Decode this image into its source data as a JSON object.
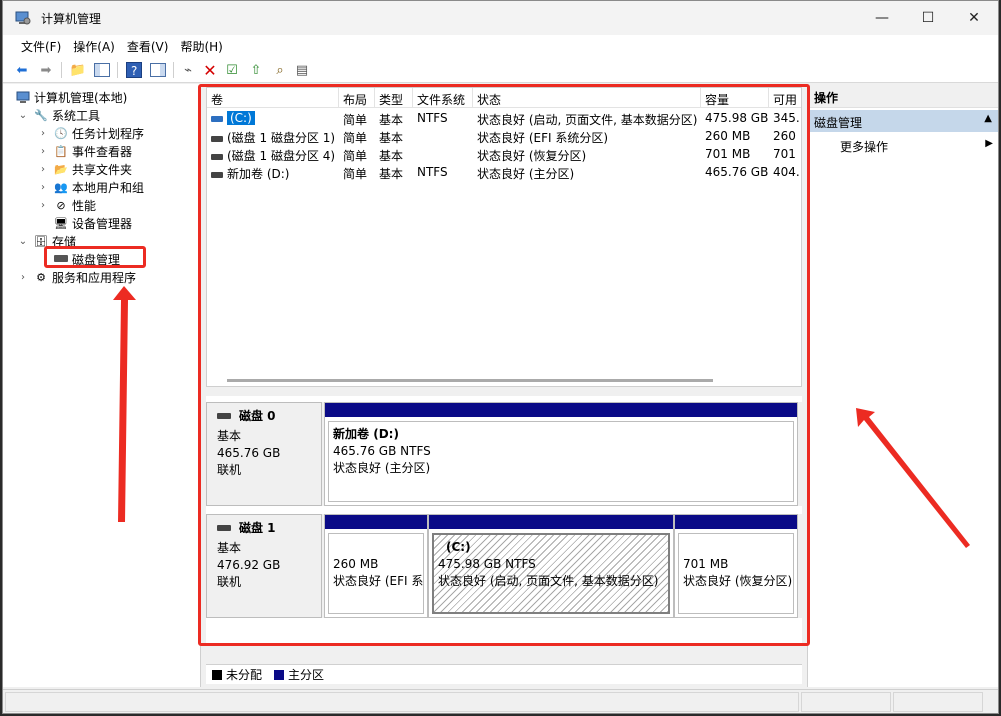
{
  "window": {
    "title": "计算机管理",
    "min": "—",
    "max": "☐",
    "close": "✕"
  },
  "menu": [
    "文件(F)",
    "操作(A)",
    "查看(V)",
    "帮助(H)"
  ],
  "tree": {
    "root": "计算机管理(本地)",
    "system_tools": "系统工具",
    "task_scheduler": "任务计划程序",
    "event_viewer": "事件查看器",
    "shared_folders": "共享文件夹",
    "local_users": "本地用户和组",
    "performance": "性能",
    "device_manager": "设备管理器",
    "storage": "存储",
    "disk_management": "磁盘管理",
    "services_apps": "服务和应用程序"
  },
  "volume_list": {
    "columns": [
      "卷",
      "布局",
      "类型",
      "文件系统",
      "状态",
      "容量",
      "可用"
    ],
    "rows": [
      {
        "vol": "(C:)",
        "layout": "简单",
        "type": "基本",
        "fs": "NTFS",
        "status": "状态良好 (启动, 页面文件, 基本数据分区)",
        "capacity": "475.98 GB",
        "free": "345."
      },
      {
        "vol": "(磁盘 1 磁盘分区 1)",
        "layout": "简单",
        "type": "基本",
        "fs": "",
        "status": "状态良好 (EFI 系统分区)",
        "capacity": "260 MB",
        "free": "260"
      },
      {
        "vol": "(磁盘 1 磁盘分区 4)",
        "layout": "简单",
        "type": "基本",
        "fs": "",
        "status": "状态良好 (恢复分区)",
        "capacity": "701 MB",
        "free": "701"
      },
      {
        "vol": "新加卷 (D:)",
        "layout": "简单",
        "type": "基本",
        "fs": "NTFS",
        "status": "状态良好 (主分区)",
        "capacity": "465.76 GB",
        "free": "404."
      }
    ]
  },
  "disks": [
    {
      "name": "磁盘 0",
      "kind": "基本",
      "size": "465.76 GB",
      "state": "联机",
      "partitions": [
        {
          "title": "新加卷",
          "letter": "(D:)",
          "size": "465.76 GB NTFS",
          "status": "状态良好 (主分区)"
        }
      ]
    },
    {
      "name": "磁盘 1",
      "kind": "基本",
      "size": "476.92 GB",
      "state": "联机",
      "partitions": [
        {
          "title": "",
          "size": "260 MB",
          "status": "状态良好 (EFI 系"
        },
        {
          "title": "(C:)",
          "size": "475.98 GB NTFS",
          "status": "状态良好 (启动, 页面文件, 基本数据分区)"
        },
        {
          "title": "",
          "size": "701 MB",
          "status": "状态良好 (恢复分区)"
        }
      ]
    }
  ],
  "legend": {
    "unallocated": "未分配",
    "primary": "主分区",
    "unallocated_color": "#000000",
    "primary_color": "#0a0a87"
  },
  "actions": {
    "header": "操作",
    "section": "磁盘管理",
    "more": "更多操作"
  },
  "colors": {
    "annotation_red": "#ec2b22",
    "selection_blue": "#0078d7"
  }
}
